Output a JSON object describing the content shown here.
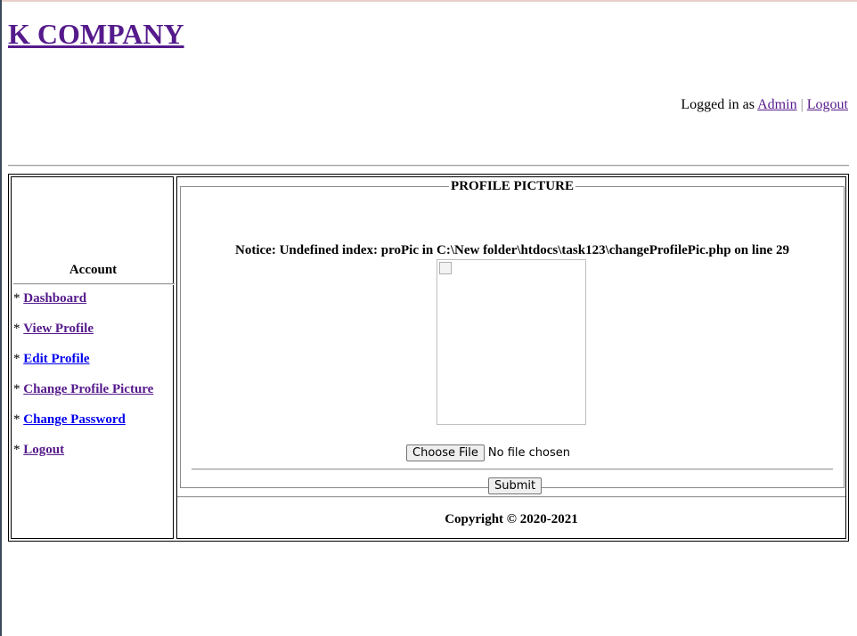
{
  "header": {
    "brand": "K COMPANY",
    "logged_in_prefix": "Logged in as ",
    "user_link": "Admin",
    "separator": "|",
    "logout_link": "Logout"
  },
  "sidebar": {
    "title": "Account",
    "bullet": "*",
    "items": [
      {
        "label": "Dashboard",
        "visited": true
      },
      {
        "label": "View Profile",
        "visited": true
      },
      {
        "label": "Edit Profile",
        "visited": false
      },
      {
        "label": "Change Profile Picture",
        "visited": true
      },
      {
        "label": "Change Password",
        "visited": false
      },
      {
        "label": "Logout",
        "visited": true
      }
    ]
  },
  "main": {
    "legend": "PROFILE PICTURE",
    "notice": "Notice: Undefined index: proPic in C:\\New folder\\htdocs\\task123\\changeProfilePic.php on line 29",
    "choose_file_label": "Choose File",
    "no_file_text": "No file chosen",
    "submit_label": "Submit",
    "footer": "Copyright © 2020-2021"
  },
  "colors": {
    "visited_link": "#551a8b",
    "unvisited_link": "#0000ee"
  }
}
